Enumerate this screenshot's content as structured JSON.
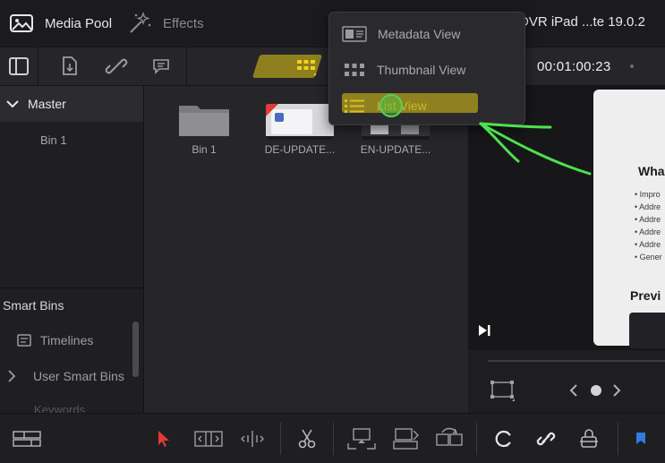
{
  "header": {
    "media_pool_label": "Media Pool",
    "effects_label": "Effects",
    "project_title": "DVR iPad ...te 19.0.2"
  },
  "toolbar": {
    "timecode": "00:01:00:23"
  },
  "view_menu": {
    "items": [
      {
        "label": "Metadata View",
        "icon": "metadata-view-icon"
      },
      {
        "label": "Thumbnail View",
        "icon": "thumbnail-view-icon"
      },
      {
        "label": "List View",
        "icon": "list-view-icon",
        "selected": true
      }
    ]
  },
  "bins": {
    "master_label": "Master",
    "bin1_label": "Bin 1"
  },
  "smart_bins": {
    "title": "Smart Bins",
    "timelines_label": "Timelines",
    "user_smart_bins_label": "User Smart Bins",
    "keywords_label": "Keywords"
  },
  "media": {
    "clips": [
      {
        "name": "Bin 1",
        "kind": "folder"
      },
      {
        "name": "DE-UPDATE...",
        "kind": "video"
      },
      {
        "name": "EN-UPDATE...",
        "kind": "video"
      }
    ]
  },
  "viewer": {
    "slide_heading": "Wha",
    "bullets": [
      "• Impro",
      "• Addre",
      "• Addre",
      "• Addre",
      "• Addre",
      "• Gener"
    ],
    "preview_heading": "Previ"
  },
  "colors": {
    "accent_yellow": "#e8c81c",
    "annotation_green": "#4ee04e",
    "selection_blue": "#2f7de0",
    "pointer_red": "#e03a3a"
  }
}
